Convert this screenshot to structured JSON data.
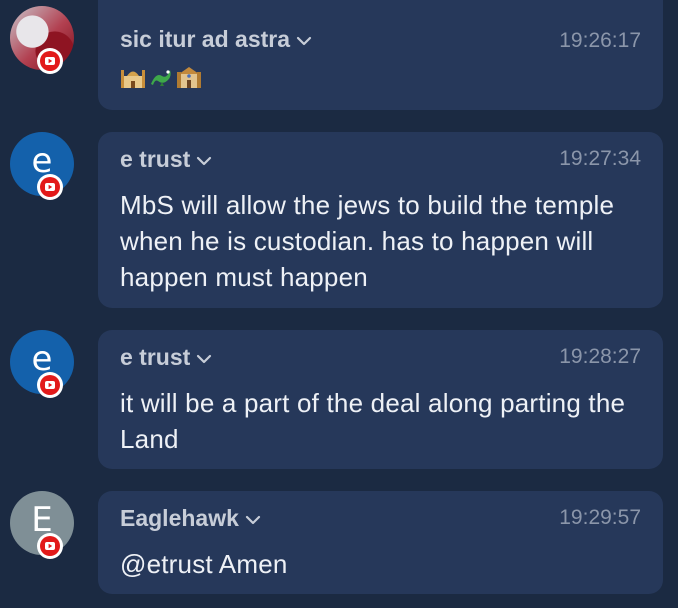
{
  "messages": [
    {
      "author": "sic itur ad astra",
      "time": "19:26:17",
      "avatar_letter": "",
      "avatar_color": "#b0303d",
      "emojis": [
        "mosque-icon",
        "dragon-icon",
        "synagogue-icon"
      ],
      "text": ""
    },
    {
      "author": "e trust",
      "time": "19:27:34",
      "avatar_letter": "e",
      "avatar_color": "#1461ab",
      "text": "MbS will allow the jews to build the temple when he is custodian. has to happen will happen must happen"
    },
    {
      "author": "e trust",
      "time": "19:28:27",
      "avatar_letter": "e",
      "avatar_color": "#1461ab",
      "text": "it will be a part of the deal along parting the Land"
    },
    {
      "author": "Eaglehawk",
      "time": "19:29:57",
      "avatar_letter": "E",
      "avatar_color": "#7f8f96",
      "text": "@etrust Amen"
    }
  ],
  "platform_badge": "youtube-icon",
  "colors": {
    "background": "#1b2a42",
    "bubble": "#26385a",
    "author": "#c7cdd8",
    "timestamp": "#8b96aa",
    "message_text": "#eef1f6",
    "badge_red": "#e21a1a"
  }
}
